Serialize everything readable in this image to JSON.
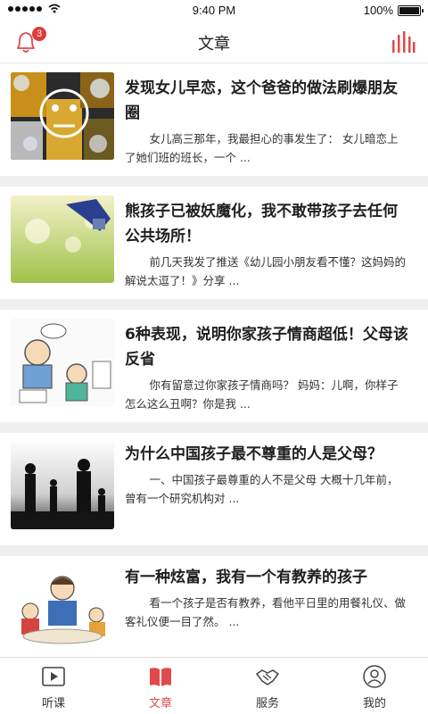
{
  "status": {
    "time": "9:40 PM",
    "battery": "100%"
  },
  "header": {
    "title": "文章",
    "badge": "3"
  },
  "articles": [
    {
      "title": "发现女儿早恋，这个爸爸的做法刷爆朋友圈",
      "summary": "女儿高三那年，我最担心的事发生了：  女儿暗恋上了她们班的班长，一个 ..."
    },
    {
      "title": "熊孩子已被妖魔化，我不敢带孩子去任何公共场所！",
      "summary": "前几天我发了推送《幼儿园小朋友看不懂？这妈妈的解说太逗了！》分享 ..."
    },
    {
      "title": "6种表现，说明你家孩子情商超低！父母该反省",
      "summary": "你有留意过你家孩子情商吗？  妈妈：儿啊，你样子怎么这么丑啊？你是我 ..."
    },
    {
      "title": "为什么中国孩子最不尊重的人是父母？",
      "summary": "一、中国孩子最尊重的人不是父母 大概十几年前，曾有一个研究机构对 ..."
    },
    {
      "title": "有一种炫富，我有一个有教养的孩子",
      "summary": "看一个孩子是否有教养，看他平日里的用餐礼仪、做客礼仪便一目了然。 ..."
    }
  ],
  "tabs": [
    {
      "label": "听课",
      "icon": "play-icon"
    },
    {
      "label": "文章",
      "icon": "book-icon"
    },
    {
      "label": "服务",
      "icon": "handshake-icon"
    },
    {
      "label": "我的",
      "icon": "user-icon"
    }
  ],
  "colors": {
    "accent": "#e04a4a"
  }
}
